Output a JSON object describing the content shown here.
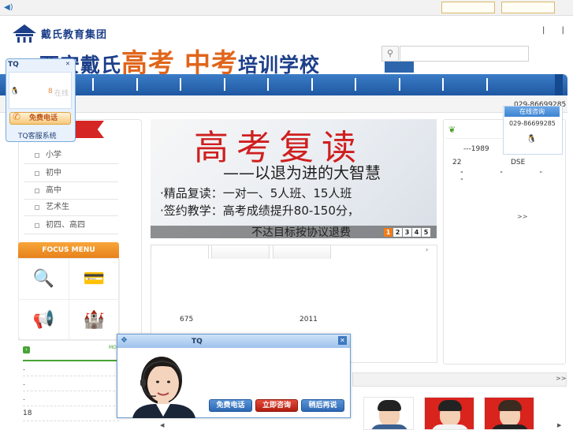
{
  "header": {
    "group_name": "戴氏教育集团",
    "school_name_part1": "西安戴氏",
    "school_name_highlight1": "高考",
    "school_name_highlight2": "中考",
    "school_name_part2": "培训学校",
    "top_links": "| |"
  },
  "search": {
    "placeholder": ""
  },
  "subbar": {
    "phone": "029-86699285"
  },
  "categories": {
    "items": [
      {
        "label": "小学"
      },
      {
        "label": "初中"
      },
      {
        "label": "高中"
      },
      {
        "label": "艺术生"
      },
      {
        "label": "初四、高四"
      }
    ]
  },
  "focus_menu": {
    "title": "FOCUS MENU"
  },
  "banner": {
    "title": "高考复读",
    "subtitle": "——以退为进的大智慧",
    "line1": "·精品复读：一对一、5人班、15人班",
    "line2": "·签约教学：高考成绩提升80-150分，",
    "line3": "不达目标按协议退费",
    "pages": [
      "1",
      "2",
      "3",
      "4",
      "5"
    ],
    "active_page": 1
  },
  "middle": {
    "arrow": "›",
    "value_675": "675",
    "value_2011": "2011"
  },
  "right_panel": {
    "year": "---1989",
    "num22": "22",
    "dse": "DSE",
    "quotes": "\" \" \" \"",
    "more": ">>"
  },
  "news": {
    "more": "MORE",
    "rows": [
      ".",
      ".",
      ".",
      ".",
      "18",
      "."
    ]
  },
  "teachers": {
    "more": ">>"
  },
  "tq_left": {
    "title": "TQ",
    "status_num": "8",
    "online": "在线",
    "free_call": "免费电话",
    "footer": "TQ客服系统"
  },
  "tq_right": {
    "header": "在线咨询",
    "phone": "029-86699285"
  },
  "tq_popup": {
    "title": "TQ",
    "btn_call": "免费电话",
    "btn_now": "立即咨询",
    "btn_later": "稍后再说"
  },
  "colors": {
    "brand_blue": "#1d3f8a",
    "accent_orange": "#e0651b",
    "nav_blue": "#2d66ad",
    "banner_red": "#cf1f1f"
  }
}
